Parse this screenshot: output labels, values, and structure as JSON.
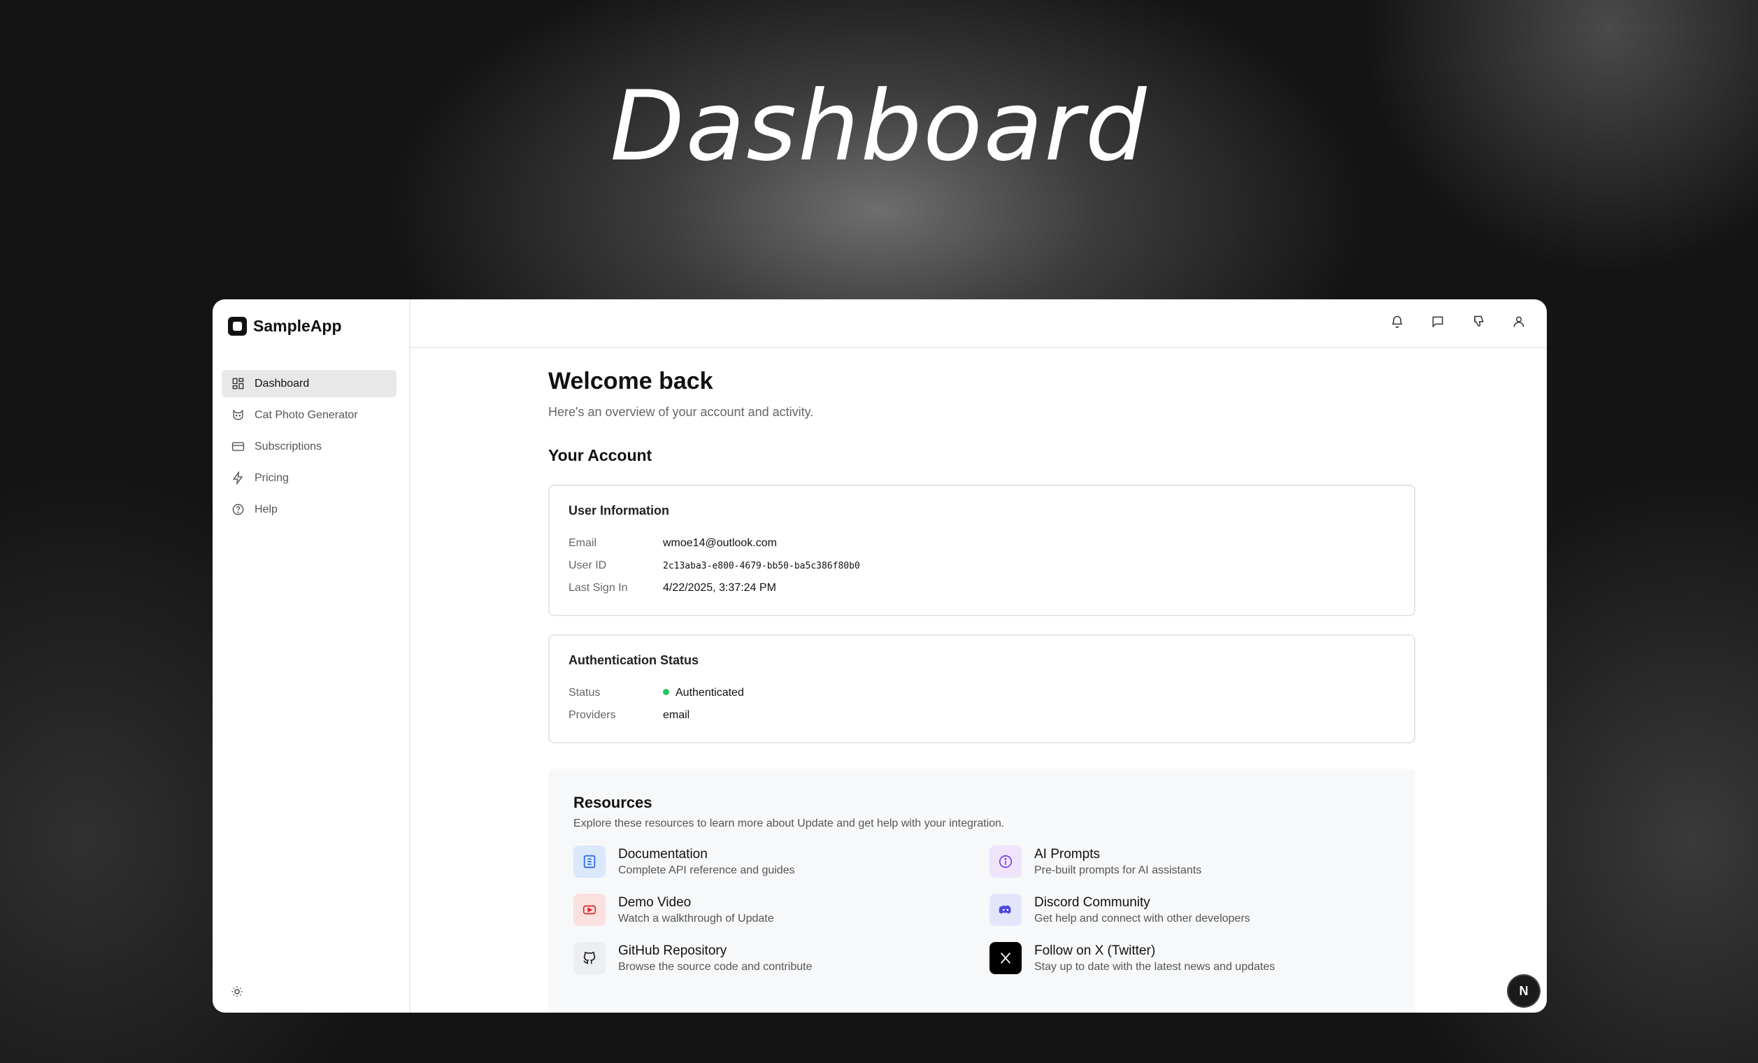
{
  "hero": {
    "title": "Dashboard"
  },
  "app": {
    "name": "SampleApp"
  },
  "sidebar": {
    "items": [
      {
        "label": "Dashboard",
        "icon": "grid-icon",
        "active": true
      },
      {
        "label": "Cat Photo Generator",
        "icon": "cat-icon"
      },
      {
        "label": "Subscriptions",
        "icon": "credit-card-icon"
      },
      {
        "label": "Pricing",
        "icon": "lightning-icon"
      },
      {
        "label": "Help",
        "icon": "help-circle-icon"
      }
    ]
  },
  "topbar": {
    "icons": [
      "bell-icon",
      "message-icon",
      "thumbs-down-icon",
      "user-icon"
    ]
  },
  "main": {
    "welcome": "Welcome back",
    "subtitle": "Here's an overview of your account and activity.",
    "section_title": "Your Account",
    "user_info": {
      "title": "User Information",
      "email_label": "Email",
      "email": "wmoe14@outlook.com",
      "user_id_label": "User ID",
      "user_id": "2c13aba3-e800-4679-bb50-ba5c386f80b0",
      "last_sign_in_label": "Last Sign In",
      "last_sign_in": "4/22/2025, 3:37:24 PM"
    },
    "auth": {
      "title": "Authentication Status",
      "status_label": "Status",
      "status": "Authenticated",
      "status_color": "#22c55e",
      "providers_label": "Providers",
      "providers": "email"
    },
    "resources": {
      "title": "Resources",
      "subtitle": "Explore these resources to learn more about Update and get help with your integration.",
      "items": [
        {
          "name": "Documentation",
          "desc": "Complete API reference and guides",
          "icon": "document-icon"
        },
        {
          "name": "AI Prompts",
          "desc": "Pre-built prompts for AI assistants",
          "icon": "info-icon"
        },
        {
          "name": "Demo Video",
          "desc": "Watch a walkthrough of Update",
          "icon": "youtube-icon"
        },
        {
          "name": "Discord Community",
          "desc": "Get help and connect with other developers",
          "icon": "discord-icon"
        },
        {
          "name": "GitHub Repository",
          "desc": "Browse the source code and contribute",
          "icon": "github-icon"
        },
        {
          "name": "Follow on X (Twitter)",
          "desc": "Stay up to date with the latest news and updates",
          "icon": "x-icon"
        }
      ]
    }
  },
  "badge": {
    "letter": "N"
  }
}
